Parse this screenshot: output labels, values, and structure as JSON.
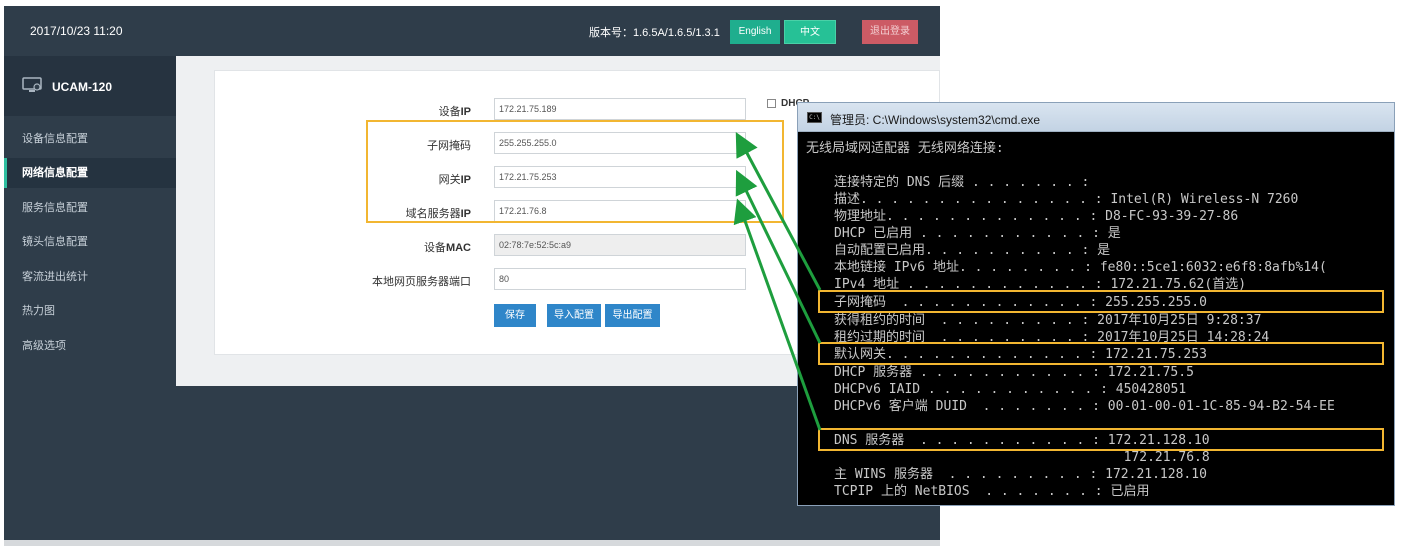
{
  "webui": {
    "datetime": "2017/10/23 11:20",
    "version": "版本号：1.6.5A/1.6.5/1.3.1",
    "btn_english": "English",
    "btn_chinese": "中文",
    "btn_logout": "退出登录",
    "device_name": "UCAM-120",
    "nav": [
      {
        "label": "设备信息配置"
      },
      {
        "label": "网络信息配置",
        "active": true
      },
      {
        "label": "服务信息配置"
      },
      {
        "label": "镜头信息配置"
      },
      {
        "label": "客流进出统计"
      },
      {
        "label": "热力图"
      },
      {
        "label": "高级选项"
      }
    ],
    "fields": [
      {
        "label_cn": "设备",
        "label_en": "IP",
        "value": "172.21.75.189"
      },
      {
        "label_cn": "子网掩码",
        "label_en": "",
        "value": "255.255.255.0"
      },
      {
        "label_cn": "网关",
        "label_en": "IP",
        "value": "172.21.75.253"
      },
      {
        "label_cn": "域名服务器",
        "label_en": "IP",
        "value": "172.21.76.8"
      },
      {
        "label_cn": "设备",
        "label_en": "MAC",
        "value": "02:78:7e:52:5c:a9"
      },
      {
        "label_cn": "本地网页服务器端口",
        "label_en": "",
        "value": "80"
      }
    ],
    "dhcp_label": "DHCP",
    "btn_save": "保存",
    "btn_import": "导入配置",
    "btn_export": "导出配置"
  },
  "cmd": {
    "title": "管理员: C:\\Windows\\system32\\cmd.exe",
    "icon_text": "C:\\",
    "header": "无线局域网适配器 无线网络连接:",
    "lines": [
      "连接特定的 DNS 后缀 . . . . . . . :",
      "描述. . . . . . . . . . . . . . . : Intel(R) Wireless-N 7260",
      "物理地址. . . . . . . . . . . . . : D8-FC-93-39-27-86",
      "DHCP 已启用 . . . . . . . . . . . : 是",
      "自动配置已启用. . . . . . . . . . : 是",
      "本地链接 IPv6 地址. . . . . . . . : fe80::5ce1:6032:e6f8:8afb%14(",
      "IPv4 地址 . . . . . . . . . . . . : 172.21.75.62(首选)",
      "子网掩码  . . . . . . . . . . . . : 255.255.255.0",
      "获得租约的时间  . . . . . . . . . : 2017年10月25日 9:28:37",
      "租约过期的时间  . . . . . . . . . : 2017年10月25日 14:28:24",
      "默认网关. . . . . . . . . . . . . : 172.21.75.253",
      "DHCP 服务器 . . . . . . . . . . . : 172.21.75.5",
      "DHCPv6 IAID . . . . . . . . . . . : 450428051",
      "DHCPv6 客户端 DUID  . . . . . . . : 00-01-00-01-1C-85-94-B2-54-EE",
      "DNS 服务器  . . . . . . . . . . . : 172.21.128.10",
      "                                     172.21.76.8",
      "主 WINS 服务器  . . . . . . . . . : 172.21.128.10",
      "TCPIP 上的 NetBIOS  . . . . . . . : 已启用"
    ]
  },
  "colors": {
    "sidebar_bg": "#2f3d4a",
    "accent_green": "#1fae8e",
    "logout_red": "#cc5b65",
    "button_blue": "#2f86c9",
    "highlight_orange": "#f2b631",
    "arrow_green": "#1e9e3e"
  }
}
